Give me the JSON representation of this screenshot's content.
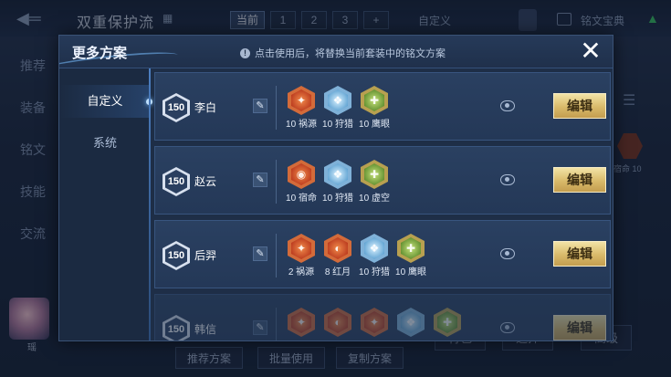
{
  "background": {
    "title": "双重保护流",
    "tabs": [
      {
        "label": "当前",
        "active": true
      },
      {
        "label": "1",
        "active": false
      },
      {
        "label": "2",
        "active": false
      },
      {
        "label": "3",
        "active": false
      },
      {
        "label": "+",
        "active": false
      }
    ],
    "custom_label": "自定义",
    "codex_label": "铭文宝典",
    "side_items": [
      "推荐",
      "装备",
      "铭文",
      "技能",
      "交流"
    ],
    "bottom_buttons": [
      "推荐方案",
      "批量使用",
      "复制方案"
    ],
    "right_buttons": [
      "背包",
      "选择",
      "高级"
    ],
    "rune_caption": "宿命 10",
    "level_caption": "瑶"
  },
  "modal": {
    "title": "更多方案",
    "notice": "点击使用后，将替换当前套装中的铭文方案",
    "close_symbol": "✕",
    "nav": [
      {
        "label": "自定义",
        "active": true
      },
      {
        "label": "系统",
        "active": false
      }
    ],
    "edit_label": "编辑",
    "plans": [
      {
        "level": "150",
        "name": "李白",
        "runes": [
          {
            "label": "10 祸源",
            "color": "red",
            "glyph": "✦"
          },
          {
            "label": "10 狩猎",
            "color": "blue",
            "glyph": "❖"
          },
          {
            "label": "10 鹰眼",
            "color": "green",
            "glyph": "✚"
          }
        ]
      },
      {
        "level": "150",
        "name": "赵云",
        "runes": [
          {
            "label": "10 宿命",
            "color": "red",
            "glyph": "◉"
          },
          {
            "label": "10 狩猎",
            "color": "blue",
            "glyph": "❖"
          },
          {
            "label": "10 虚空",
            "color": "green",
            "glyph": "✚"
          }
        ]
      },
      {
        "level": "150",
        "name": "后羿",
        "runes": [
          {
            "label": "2 祸源",
            "color": "red",
            "glyph": "✦"
          },
          {
            "label": "8 红月",
            "color": "red",
            "glyph": "◐"
          },
          {
            "label": "10 狩猎",
            "color": "blue",
            "glyph": "❖"
          },
          {
            "label": "10 鹰眼",
            "color": "green",
            "glyph": "✚"
          }
        ]
      },
      {
        "level": "150",
        "name": "韩信",
        "runes": [
          {
            "label": "",
            "color": "red",
            "glyph": "✦"
          },
          {
            "label": "",
            "color": "red",
            "glyph": "◐"
          },
          {
            "label": "",
            "color": "red",
            "glyph": "✦"
          },
          {
            "label": "",
            "color": "blue",
            "glyph": "❖"
          },
          {
            "label": "",
            "color": "green",
            "glyph": "✚"
          }
        ]
      }
    ]
  },
  "colors": {
    "accent_gold": "#d9ba6a",
    "panel_blue": "#243857",
    "highlight": "#7cc0ff"
  }
}
